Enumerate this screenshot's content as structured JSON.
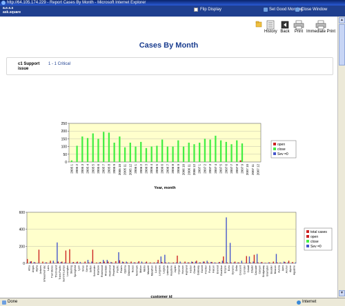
{
  "window": {
    "title": "http://64.105.174.229 - Report Cases By Month - Microsoft Internet Explorer"
  },
  "header": {
    "logo_line1": "a.e.s.s",
    "logo_line2": "ask.square",
    "flip_display": "Flip Display",
    "set_good_morning": "Set Good Morning",
    "close_window": "Close Window"
  },
  "toolbar": {
    "history": "History",
    "back": "Back",
    "print": "Print",
    "immediate_print": "Immediate Print"
  },
  "page": {
    "title": "Cases By Month",
    "filter_label_line1": "c1 Support",
    "filter_label_line2": "issue",
    "filter_value": "1 - 1 Critical"
  },
  "status": {
    "left": "Done",
    "right": "Internet"
  },
  "colors": {
    "open": "#cc2222",
    "close": "#44ee44",
    "sev": "#4455cc",
    "plot_bg": "#ffffcc"
  },
  "chart_data": [
    {
      "type": "bar",
      "xlabel": "Year, month",
      "ylabel": "",
      "ylim": [
        0,
        250
      ],
      "yticks": [
        0,
        50,
        100,
        150,
        200,
        250
      ],
      "categories": [
        "2005 1",
        "2005 2",
        "2005 3",
        "2005 4",
        "2005 5",
        "2005 6",
        "2005 7",
        "2005 8",
        "2005 9",
        "2005 10",
        "2005 11",
        "2005 12",
        "2006 1",
        "2006 2",
        "2006 3",
        "2006 4",
        "2006 5",
        "2006 6",
        "2006 7",
        "2006 8",
        "2006 9",
        "2006 10",
        "2006 11",
        "2006 12",
        "2007 1",
        "2007 2",
        "2007 3",
        "2007 4",
        "2007 5",
        "2007 6",
        "2007 7",
        "2007 8",
        "2007 9",
        "2007 10",
        "2007 11",
        "2007 12"
      ],
      "series": [
        {
          "name": "open",
          "values": [
            0,
            0,
            0,
            0,
            0,
            0,
            0,
            0,
            0,
            0,
            0,
            0,
            0,
            0,
            0,
            0,
            0,
            0,
            0,
            0,
            0,
            0,
            0,
            0,
            0,
            0,
            0,
            0,
            0,
            0,
            0,
            0,
            10,
            0,
            0,
            0
          ]
        },
        {
          "name": "close",
          "values": [
            10,
            105,
            165,
            155,
            185,
            150,
            195,
            190,
            125,
            165,
            95,
            125,
            100,
            130,
            90,
            100,
            105,
            145,
            100,
            100,
            140,
            100,
            125,
            115,
            125,
            150,
            145,
            170,
            140,
            130,
            115,
            140,
            120,
            0,
            0,
            0
          ]
        },
        {
          "name": "Sev =0",
          "values": [
            0,
            0,
            0,
            0,
            0,
            0,
            0,
            0,
            0,
            0,
            0,
            0,
            0,
            0,
            0,
            0,
            0,
            0,
            0,
            0,
            0,
            0,
            0,
            0,
            0,
            0,
            0,
            0,
            0,
            0,
            0,
            0,
            0,
            0,
            0,
            0
          ]
        }
      ]
    },
    {
      "type": "bar",
      "xlabel": "customer id",
      "ylabel": "",
      "ylim": [
        0,
        600
      ],
      "yticks": [
        0,
        200,
        400,
        600
      ],
      "categories": [
        "Aifcu",
        "Airgas",
        "Alpha",
        "Antares",
        "Unleashed Vac",
        "Lans",
        "Trail Stores",
        "Third Hand",
        "Trans Pacific",
        "Summit Lamps",
        "Lexington",
        "Sterling",
        "Springfield",
        "Lyon",
        "Sirius",
        "Sierra",
        "Sefton",
        "Schneider",
        "Rainbow",
        "Rosewood",
        "Riverdale",
        "Redmond",
        "Perpetual",
        "Pacific",
        "Polaris",
        "Optima",
        "Oakwood",
        "Nexus",
        "Newmark",
        "Motion",
        "Metro",
        "Maxwell",
        "Marathon",
        "Lumen",
        "Longview",
        "Legacy",
        "Lakeside",
        "Keystone",
        "Jupiter",
        "Imperial",
        "Horizon",
        "Highland",
        "Harbor",
        "Granite",
        "Gateway",
        "Garnet",
        "Frontier",
        "Fusion",
        "Falcon",
        "Everest",
        "Excalibur",
        "Empire",
        "Echo",
        "Dynamo",
        "Delta",
        "Crescent",
        "Corridor",
        "Cobalt",
        "Citadel",
        "Cascade",
        "Canyon",
        "Bridgeway",
        "Brampton",
        "Boulder",
        "Beacon",
        "Aurora",
        "Apex",
        "Anchor",
        "Alpine",
        "Aqualine"
      ],
      "series": [
        {
          "name": "total cases",
          "values": [
            50,
            25,
            10,
            160,
            20,
            10,
            30,
            5,
            20,
            20,
            150,
            165,
            15,
            20,
            5,
            20,
            10,
            160,
            10,
            15,
            20,
            20,
            10,
            25,
            35,
            15,
            10,
            20,
            10,
            25,
            5,
            20,
            10,
            10,
            40,
            15,
            10,
            5,
            10,
            90,
            5,
            20,
            10,
            15,
            30,
            10,
            20,
            10,
            15,
            5,
            15,
            80,
            10,
            10,
            20,
            10,
            5,
            85,
            10,
            100,
            10,
            15,
            5,
            10,
            20,
            10,
            5,
            15,
            30,
            15
          ]
        },
        {
          "name": "open",
          "values": [
            0,
            0,
            0,
            0,
            0,
            0,
            0,
            0,
            0,
            0,
            0,
            0,
            0,
            0,
            0,
            0,
            0,
            0,
            0,
            0,
            0,
            0,
            0,
            0,
            0,
            0,
            0,
            0,
            0,
            0,
            0,
            0,
            0,
            0,
            0,
            0,
            0,
            0,
            0,
            0,
            0,
            0,
            0,
            0,
            0,
            0,
            0,
            0,
            0,
            0,
            0,
            0,
            0,
            0,
            0,
            0,
            0,
            0,
            0,
            0,
            0,
            0,
            0,
            0,
            0,
            0,
            0,
            0,
            0,
            0
          ]
        },
        {
          "name": "close",
          "values": [
            0,
            0,
            0,
            0,
            0,
            0,
            0,
            0,
            0,
            0,
            0,
            0,
            0,
            0,
            0,
            0,
            0,
            0,
            0,
            0,
            0,
            0,
            0,
            0,
            0,
            0,
            0,
            0,
            0,
            0,
            0,
            0,
            0,
            0,
            0,
            0,
            0,
            0,
            0,
            0,
            0,
            0,
            0,
            0,
            0,
            0,
            0,
            0,
            0,
            0,
            0,
            0,
            0,
            0,
            0,
            0,
            0,
            0,
            0,
            0,
            0,
            0,
            0,
            0,
            0,
            0,
            0,
            0,
            0,
            0
          ]
        },
        {
          "name": "Sev =0",
          "values": [
            20,
            15,
            5,
            0,
            10,
            5,
            30,
            245,
            15,
            10,
            0,
            10,
            10,
            15,
            5,
            40,
            20,
            0,
            10,
            40,
            40,
            15,
            5,
            130,
            20,
            20,
            5,
            10,
            10,
            20,
            10,
            5,
            5,
            10,
            80,
            100,
            10,
            5,
            10,
            20,
            5,
            10,
            20,
            20,
            10,
            20,
            30,
            15,
            10,
            10,
            30,
            540,
            240,
            10,
            10,
            30,
            5,
            80,
            20,
            110,
            10,
            5,
            10,
            5,
            110,
            10,
            20,
            10,
            5,
            10
          ]
        }
      ]
    }
  ]
}
